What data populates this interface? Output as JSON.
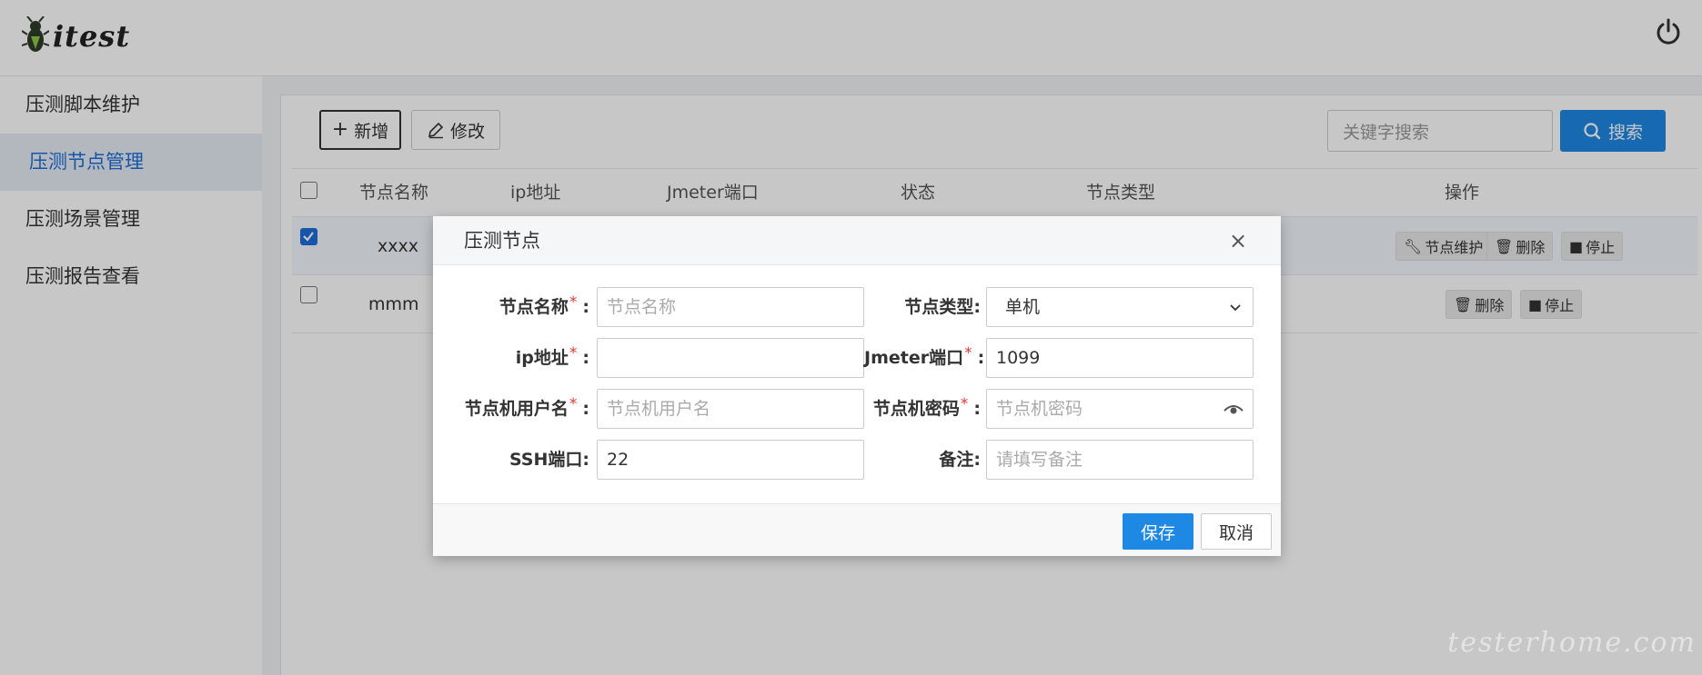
{
  "header": {
    "logo_text": "itest",
    "logo_icon": "bug-icon",
    "power_icon": "power-icon"
  },
  "sidebar": {
    "items": [
      {
        "label": "压测脚本维护"
      },
      {
        "label": "压测节点管理",
        "active": true
      },
      {
        "label": "压测场景管理"
      },
      {
        "label": "压测报告查看"
      }
    ]
  },
  "toolbar": {
    "add_label": "新增",
    "edit_label": "修改",
    "search_placeholder": "关键字搜索",
    "search_label": "搜索"
  },
  "table": {
    "columns": [
      "节点名称",
      "ip地址",
      "Jmeter端口",
      "状态",
      "节点类型",
      "操作"
    ],
    "rows": [
      {
        "name": "xxxx",
        "checked": true,
        "actions": [
          "节点维护",
          "删除",
          "停止"
        ]
      },
      {
        "name": "mmm",
        "checked": false,
        "actions": [
          "删除",
          "停止"
        ]
      }
    ]
  },
  "modal": {
    "title": "压测节点",
    "close": "×",
    "fields": {
      "node_name": {
        "label": "节点名称",
        "required": true,
        "value": "",
        "placeholder": "节点名称"
      },
      "node_type": {
        "label": "节点类型",
        "required": false,
        "value": "单机"
      },
      "ip": {
        "label": "ip地址",
        "required": true,
        "value": "",
        "placeholder": ""
      },
      "jmeter_port": {
        "label": "Jmeter端口",
        "required": true,
        "value": "1099"
      },
      "username": {
        "label": "节点机用户名",
        "required": true,
        "value": "",
        "placeholder": "节点机用户名"
      },
      "password": {
        "label": "节点机密码",
        "required": true,
        "value": "",
        "placeholder": "节点机密码"
      },
      "ssh_port": {
        "label": "SSH端口",
        "required": false,
        "value": "22"
      },
      "remark": {
        "label": "备注",
        "required": false,
        "value": "",
        "placeholder": "请填写备注"
      }
    },
    "save_label": "保存",
    "cancel_label": "取消"
  },
  "watermark": "testerhome.com",
  "colors": {
    "primary": "#1e88e5",
    "active_menu_text": "#1e6ed8",
    "required": "#e53935"
  }
}
